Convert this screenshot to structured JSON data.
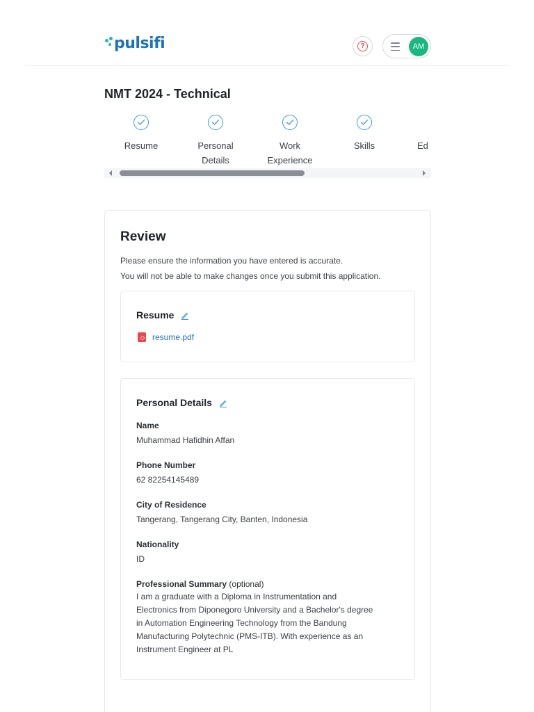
{
  "header": {
    "logo_text": "pulsifi",
    "help_icon": "question-circle-icon",
    "help_glyph": "?",
    "menu_icon": "hamburger-menu-icon",
    "avatar_initials": "AM"
  },
  "page": {
    "title": "NMT 2024 - Technical"
  },
  "stepper": {
    "steps": [
      {
        "label": "Resume",
        "status": "completed",
        "icon": "check-circle-icon"
      },
      {
        "label": "Personal Details",
        "status": "completed",
        "icon": "check-circle-icon"
      },
      {
        "label": "Work Experience",
        "status": "completed",
        "icon": "check-circle-icon"
      },
      {
        "label": "Skills",
        "status": "completed",
        "icon": "check-circle-icon"
      },
      {
        "label": "Ed",
        "status": "partially-visible"
      }
    ]
  },
  "review": {
    "title": "Review",
    "desc_line1": "Please ensure the information you have entered is accurate.",
    "desc_line2": "You will not be able to make changes once you submit this application.",
    "resume": {
      "heading": "Resume",
      "edit_icon": "pencil-edit-icon",
      "file_icon": "pdf-file-icon",
      "file_name": "resume.pdf"
    },
    "personal": {
      "heading": "Personal Details",
      "edit_icon": "pencil-edit-icon",
      "fields": [
        {
          "label": "Name",
          "value": "Muhammad Hafidhin Affan"
        },
        {
          "label": "Phone Number",
          "value": "62 82254145489"
        },
        {
          "label": "City of Residence",
          "value": "Tangerang, Tangerang City, Banten, Indonesia"
        },
        {
          "label": "Nationality",
          "value": "ID"
        },
        {
          "label": "Professional Summary",
          "label_suffix": "(optional)",
          "value_lines": [
            "I am a graduate with a Diploma in Instrumentation and",
            "Electronics from Diponegoro University and a Bachelor's degree",
            "in Automation Engineering Technology from the Bandung",
            "Manufacturing Polytechnic (PMS-ITB). With experience as an",
            "Instrument Engineer at PL"
          ]
        }
      ]
    }
  },
  "colors": {
    "brand_blue": "#1e72b8",
    "brand_teal": "#22b8b1",
    "check_blue": "#3d9be9",
    "avatar_green": "#1bb783",
    "pdf_red": "#e5484d"
  }
}
